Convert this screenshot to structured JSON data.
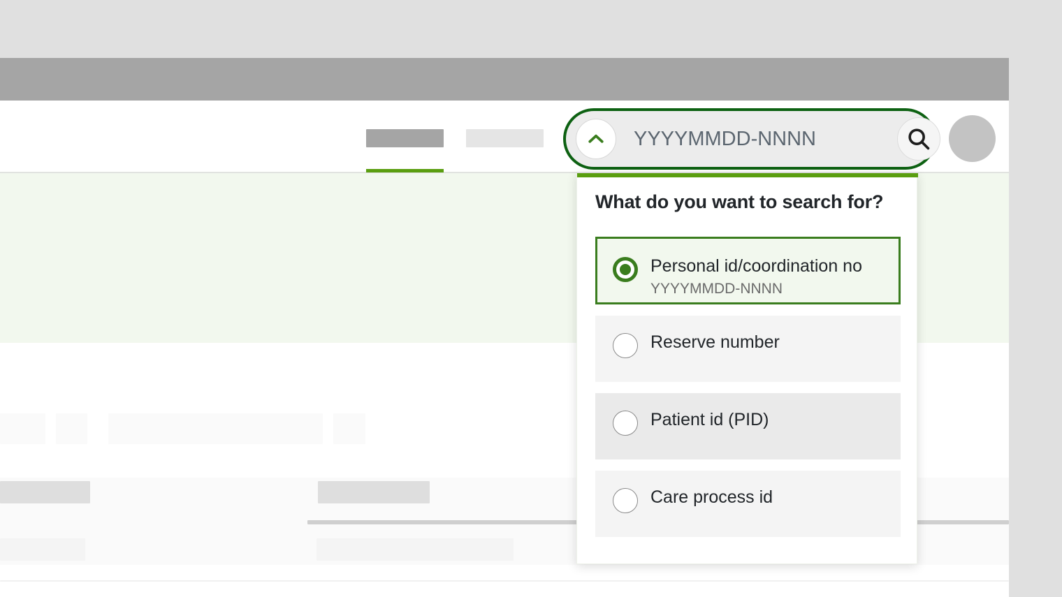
{
  "header": {
    "nav_tabs": [
      {
        "name": "active-tab",
        "state": "active"
      },
      {
        "name": "inactive-tab",
        "state": "inactive"
      }
    ],
    "avatar_label": ""
  },
  "search": {
    "value": "",
    "placeholder": "YYYYMMDD-NNNN",
    "collapse_icon": "chevron-up-icon",
    "submit_icon": "search-icon",
    "border_color": "#0d6112",
    "field_bg": "#ececec"
  },
  "dropdown": {
    "title": "What do you want to search for?",
    "accent_color": "#5a9e10",
    "selected_border_color": "#3a7d1e",
    "selected_bg": "#f2f8ee",
    "options": [
      {
        "label": "Personal id/coordination no",
        "hint": "YYYYMMDD-NNNN",
        "selected": true,
        "state": "selected"
      },
      {
        "label": "Reserve number",
        "hint": "",
        "selected": false,
        "state": "default"
      },
      {
        "label": "Patient id (PID)",
        "hint": "",
        "selected": false,
        "state": "hover"
      },
      {
        "label": "Care process id",
        "hint": "",
        "selected": false,
        "state": "default"
      }
    ]
  },
  "banner": {
    "background_color": "#f2f8ee"
  },
  "colors": {
    "page_background": "#e0e0e0",
    "app_bar": "#a5a5a5",
    "surface": "#ffffff"
  }
}
